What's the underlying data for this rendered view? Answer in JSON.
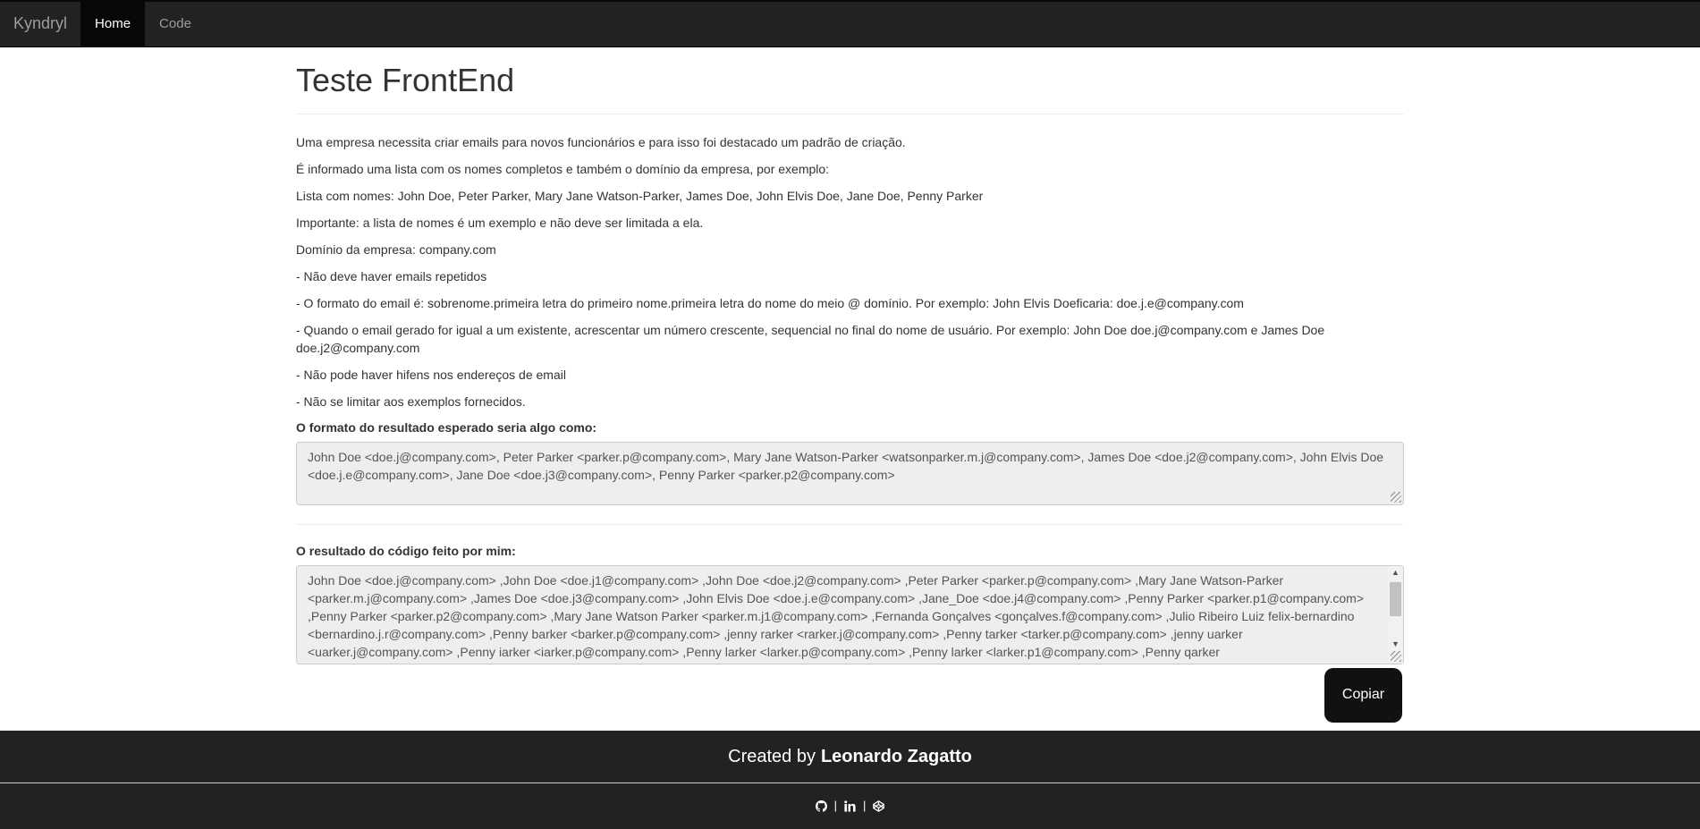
{
  "navbar": {
    "brand": "Kyndryl",
    "items": [
      {
        "label": "Home",
        "active": true
      },
      {
        "label": "Code",
        "active": false
      }
    ]
  },
  "page": {
    "title": "Teste FrontEnd",
    "paragraphs": [
      "Uma empresa necessita criar emails para novos funcionários e para isso foi destacado um padrão de criação.",
      "É informado uma lista com os nomes completos e também o domínio da empresa, por exemplo:",
      "Lista com nomes: John Doe, Peter Parker, Mary Jane Watson-Parker, James Doe, John Elvis Doe, Jane Doe, Penny Parker",
      "Importante: a lista de nomes é um exemplo e não deve ser limitada a ela.",
      "Domínio da empresa: company.com",
      "- Não deve haver emails repetidos",
      "- O formato do email é: sobrenome.primeira letra do primeiro nome.primeira letra do nome do meio @ domínio. Por exemplo: John Elvis Doeficaria: doe.j.e@company.com",
      "- Quando o email gerado for igual a um existente, acrescentar um número crescente, sequencial no final do nome de usuário. Por exemplo: John Doe doe.j@company.com e James Doe doe.j2@company.com",
      "- Não pode haver hifens nos endereços de email",
      "- Não se limitar aos exemplos fornecidos."
    ],
    "expected_label": "O formato do resultado esperado seria algo como:",
    "expected_value": "John Doe <doe.j@company.com>, Peter Parker <parker.p@company.com>, Mary Jane Watson-Parker <watsonparker.m.j@company.com>, James Doe <doe.j2@company.com>, John Elvis Doe <doe.j.e@company.com>, Jane Doe <doe.j3@company.com>, Penny Parker <parker.p2@company.com>",
    "result_label": "O resultado do código feito por mim:",
    "result_value": "John Doe <doe.j@company.com> ,John Doe <doe.j1@company.com> ,John Doe <doe.j2@company.com> ,Peter Parker <parker.p@company.com> ,Mary Jane Watson-Parker <parker.m.j@company.com> ,James Doe <doe.j3@company.com> ,John Elvis Doe <doe.j.e@company.com> ,Jane_Doe <doe.j4@company.com> ,Penny Parker <parker.p1@company.com> ,Penny Parker <parker.p2@company.com> ,Mary Jane Watson Parker <parker.m.j1@company.com> ,Fernanda Gonçalves <gonçalves.f@company.com> ,Julio Ribeiro Luiz felix-bernardino <bernardino.j.r@company.com> ,Penny barker <barker.p@company.com> ,jenny rarker <rarker.j@company.com> ,Penny tarker <tarker.p@company.com> ,jenny uarker <uarker.j@company.com> ,Penny iarker <iarker.p@company.com> ,Penny larker <larker.p@company.com> ,Penny larker <larker.p1@company.com> ,Penny qarker",
    "copy_button": "Copiar"
  },
  "footer": {
    "created_by_prefix": "Created by",
    "author": "Leonardo Zagatto",
    "separator": "|",
    "icons": [
      "github-icon",
      "linkedin-icon",
      "codepen-icon"
    ]
  }
}
